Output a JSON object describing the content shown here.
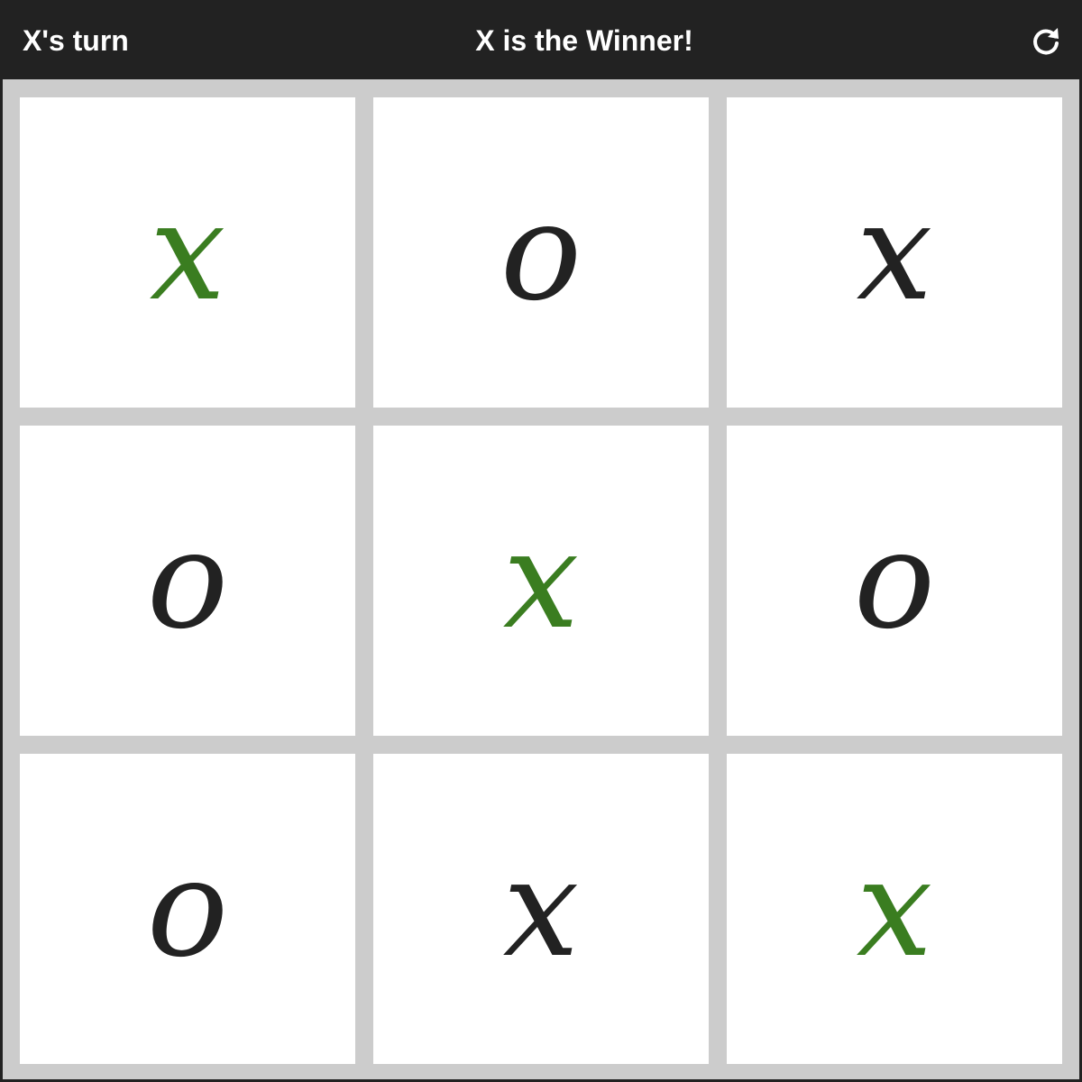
{
  "header": {
    "turn_text": "X's turn",
    "status_text": "X is the Winner!",
    "reset_icon": "refresh-icon"
  },
  "board": {
    "cells": [
      {
        "mark": "x",
        "winning": true
      },
      {
        "mark": "o",
        "winning": false
      },
      {
        "mark": "x",
        "winning": false
      },
      {
        "mark": "o",
        "winning": false
      },
      {
        "mark": "x",
        "winning": true
      },
      {
        "mark": "o",
        "winning": false
      },
      {
        "mark": "o",
        "winning": false
      },
      {
        "mark": "x",
        "winning": false
      },
      {
        "mark": "x",
        "winning": true
      }
    ]
  },
  "colors": {
    "header_bg": "#222222",
    "board_bg": "#cccccc",
    "cell_bg": "#ffffff",
    "mark_color": "#222222",
    "winning_mark_color": "#3a7d20"
  }
}
